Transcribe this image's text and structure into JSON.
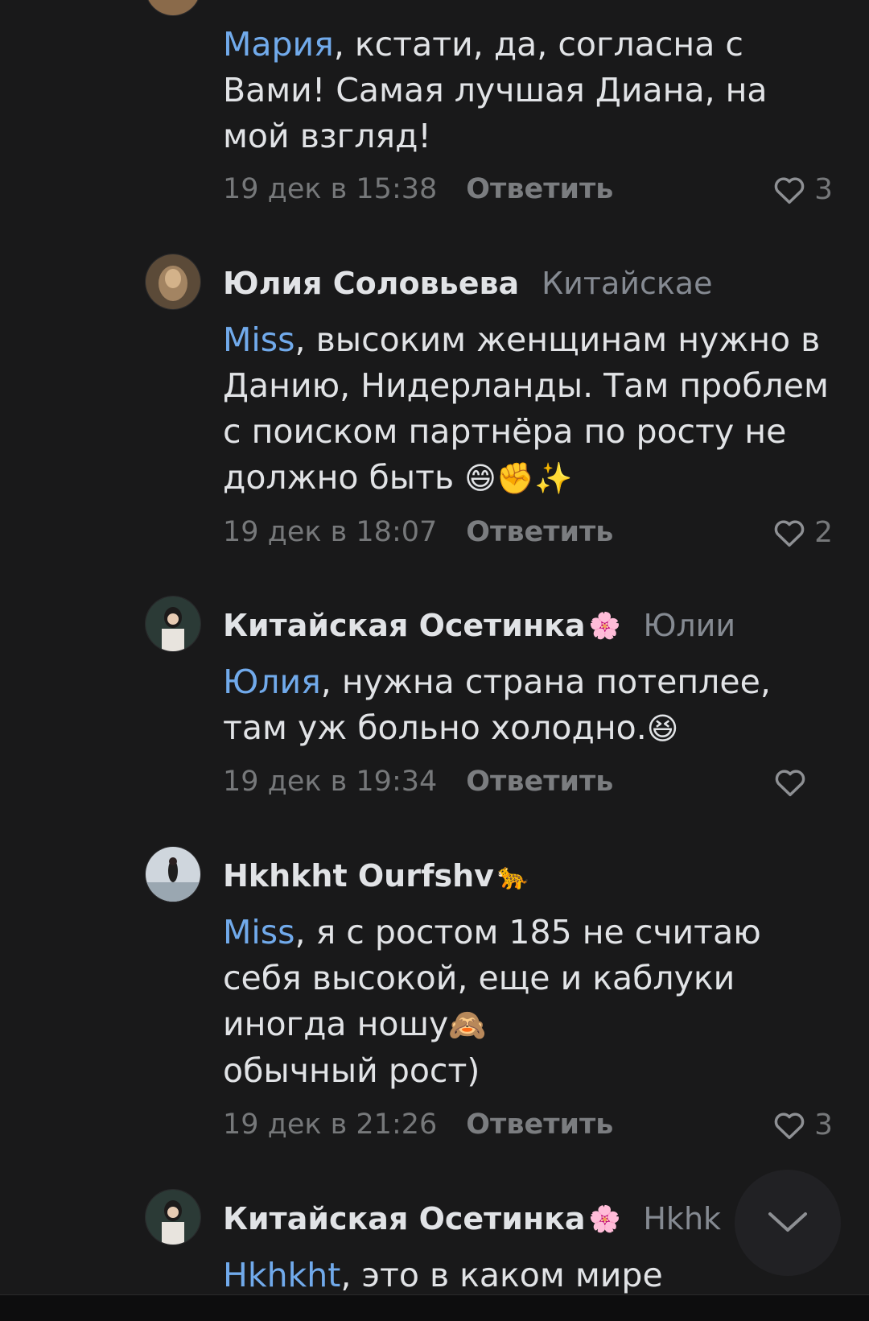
{
  "comments": [
    {
      "author": "",
      "reply_to": "",
      "mention": "Мария",
      "text": ", кстати, да, согласна с Вами! Самая лучшая Диана, на мой взгляд!",
      "date": "19 дек в 15:38",
      "reply_label": "Ответить",
      "likes": "3"
    },
    {
      "author": "Юлия Соловьева",
      "reply_to": "Китайскае",
      "mention": "Miss",
      "text": ", высоким женщинам нужно в Данию, Нидерланды. Там проблем с поиском партнёра по росту не должно быть",
      "emoji": "😄✊✨",
      "date": "19 дек в 18:07",
      "reply_label": "Ответить",
      "likes": "2"
    },
    {
      "author": "Китайская Осетинка",
      "author_badge": "🌸",
      "reply_to": "Юлии",
      "mention": "Юлия",
      "text": ", нужна страна потеплее, там уж больно холодно.",
      "emoji": "😆",
      "date": "19 дек в 19:34",
      "reply_label": "Ответить",
      "likes": ""
    },
    {
      "author": "Hkhkht Ourfshv",
      "author_badge": "🐆",
      "reply_to": "",
      "mention": "Miss",
      "text": ", я с ростом 185 не считаю себя высокой, еще и каблуки иногда ношу",
      "emoji": "🙈",
      "text2": "обычный рост)",
      "date": "19 дек в 21:26",
      "reply_label": "Ответить",
      "likes": "3"
    },
    {
      "author": "Китайская Осетинка",
      "author_badge": "🌸",
      "reply_to": "Hkhk",
      "mention": "Hkhkht",
      "text": ", это в каком мире"
    }
  ],
  "icons": {
    "like": "heart-outline-icon",
    "scroll": "chevron-down-icon"
  },
  "colors": {
    "background": "#19191a",
    "text": "#e1e3e6",
    "mention": "#71aaeb",
    "muted": "#76787a"
  }
}
